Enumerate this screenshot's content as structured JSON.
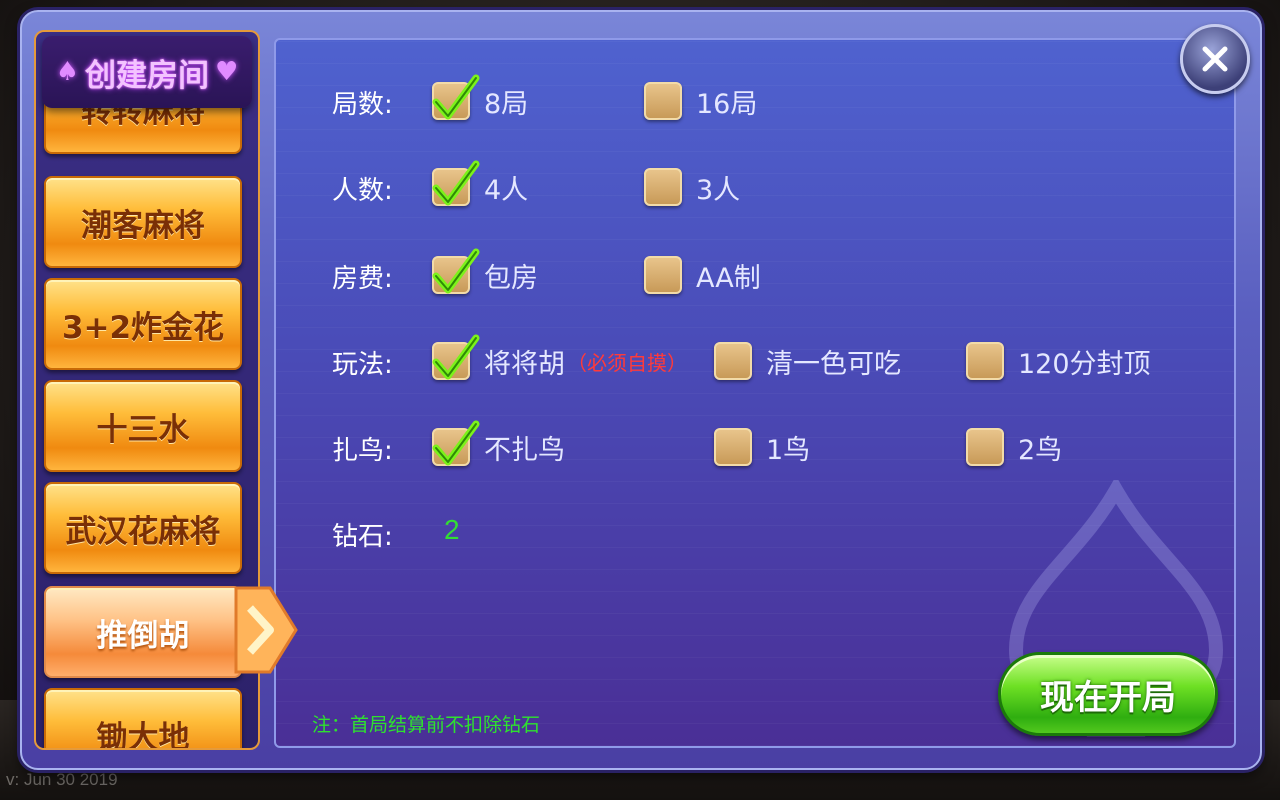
{
  "version": "v: Jun 30 2019",
  "sidebar": {
    "title": "创建房间",
    "items": [
      {
        "label": "转转麻将",
        "active": false
      },
      {
        "label": "潮客麻将",
        "active": false
      },
      {
        "label": "3+2炸金花",
        "active": false
      },
      {
        "label": "十三水",
        "active": false
      },
      {
        "label": "武汉花麻将",
        "active": false
      },
      {
        "label": "推倒胡",
        "active": true
      },
      {
        "label": "锄大地",
        "active": false
      }
    ]
  },
  "settings": {
    "rounds": {
      "label": "局数:",
      "options": [
        {
          "label": "8局",
          "checked": true
        },
        {
          "label": "16局",
          "checked": false
        }
      ]
    },
    "players": {
      "label": "人数:",
      "options": [
        {
          "label": "4人",
          "checked": true
        },
        {
          "label": "3人",
          "checked": false
        }
      ]
    },
    "fee": {
      "label": "房费:",
      "options": [
        {
          "label": "包房",
          "checked": true
        },
        {
          "label": "AA制",
          "checked": false
        }
      ]
    },
    "rules": {
      "label": "玩法:",
      "options": [
        {
          "label": "将将胡",
          "note": "（必须自摸）",
          "checked": true
        },
        {
          "label": "清一色可吃",
          "checked": false
        },
        {
          "label": "120分封顶",
          "checked": false
        }
      ]
    },
    "birds": {
      "label": "扎鸟:",
      "options": [
        {
          "label": "不扎鸟",
          "checked": true
        },
        {
          "label": "1鸟",
          "checked": false
        },
        {
          "label": "2鸟",
          "checked": false
        }
      ]
    },
    "diamonds": {
      "label": "钻石:",
      "value": "2"
    }
  },
  "footnote": "注：首局结算前不扣除钻石",
  "start_button": "现在开局",
  "colors": {
    "accent_green": "#33dd33",
    "note_red": "#ff3a3a",
    "btn_orange": "#f08a10"
  }
}
